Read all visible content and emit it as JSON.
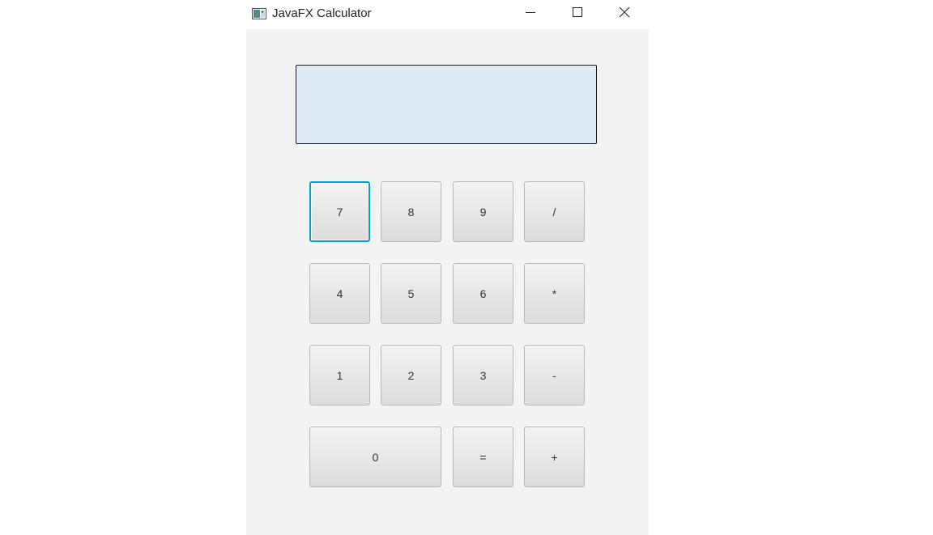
{
  "window": {
    "title": "JavaFX Calculator",
    "app_icon": "javafx-window-icon",
    "controls": {
      "minimize_icon": "minimize-icon",
      "maximize_icon": "maximize-icon",
      "close_icon": "close-icon"
    }
  },
  "display": {
    "value": ""
  },
  "keys": {
    "seven": "7",
    "eight": "8",
    "nine": "9",
    "divide": "/",
    "four": "4",
    "five": "5",
    "six": "6",
    "multiply": "*",
    "one": "1",
    "two": "2",
    "three": "3",
    "subtract": "-",
    "zero": "0",
    "equals": "=",
    "add": "+"
  },
  "colors": {
    "display_background": "#e1ebf4",
    "panel_background": "#f3f3f3",
    "focus_ring": "#039ed3"
  }
}
